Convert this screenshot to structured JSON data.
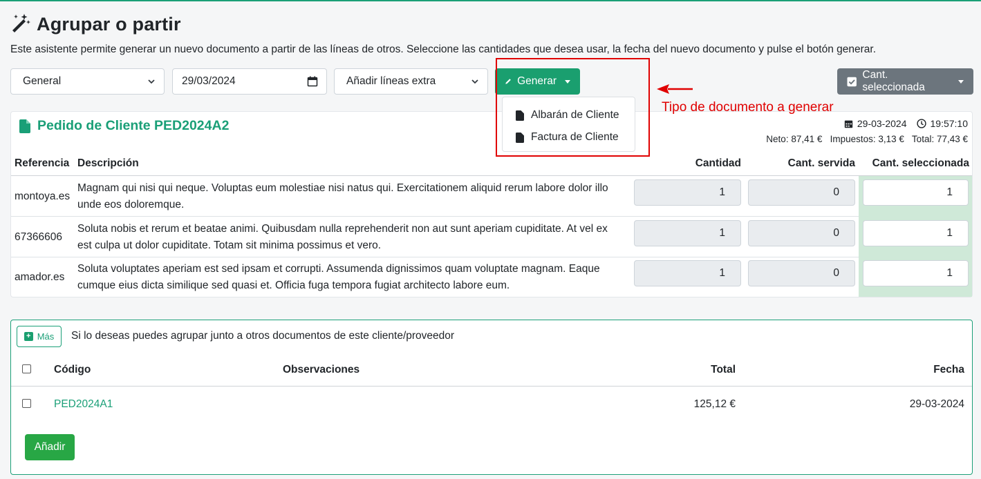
{
  "page": {
    "title": "Agrupar o partir",
    "intro": "Este asistente permite generar un nuevo documento a partir de las líneas de otros. Seleccione las cantidades que desea usar, la fecha del nuevo documento y pulse el botón generar."
  },
  "toolbar": {
    "type_select": "General",
    "date_value": "29/03/2024",
    "extra_select": "Añadir líneas extra",
    "generate_label": "Generar",
    "dropdown_items": [
      "Albarán de Cliente",
      "Factura de Cliente"
    ],
    "selected_qty_label": "Cant. seleccionada"
  },
  "annotation": "Tipo de documento a generar",
  "document": {
    "title": "Pedido de Cliente PED2024A2",
    "date": "29-03-2024",
    "time": "19:57:10",
    "totals": "Neto: 87,41 €   Impuestos: 3,13 €   Total: 77,43 €",
    "headers": {
      "ref": "Referencia",
      "desc": "Descripción",
      "qty": "Cantidad",
      "served": "Cant. servida",
      "selected": "Cant. seleccionada"
    },
    "lines": [
      {
        "ref": "montoya.es",
        "desc1": "Magnam qui nisi qui neque. Voluptas eum molestiae nisi natus qui. Exercitationem aliquid rerum labore dolor illo",
        "desc2": "unde eos doloremque.",
        "qty": "1",
        "served": "0",
        "selected": "1"
      },
      {
        "ref": "67366606",
        "desc1": "Soluta nobis et rerum et beatae animi. Quibusdam nulla reprehenderit non aut sunt aperiam cupiditate. At vel ex",
        "desc2": "est culpa ut dolor cupiditate. Totam sit minima possimus et vero.",
        "qty": "1",
        "served": "0",
        "selected": "1"
      },
      {
        "ref": "amador.es",
        "desc1": "Soluta voluptates aperiam est sed ipsam et corrupti. Assumenda dignissimos quam voluptate magnam. Eaque",
        "desc2": "cumque eius dicta similique sed quasi et. Officia fuga tempora fugiat architecto labore eum.",
        "qty": "1",
        "served": "0",
        "selected": "1"
      }
    ]
  },
  "group": {
    "more_label": "Más",
    "hint": "Si lo deseas puedes agrupar junto a otros documentos de este cliente/proveedor",
    "headers": {
      "code": "Código",
      "notes": "Observaciones",
      "total": "Total",
      "date": "Fecha"
    },
    "rows": [
      {
        "code": "PED2024A1",
        "notes": "",
        "total": "125,12 €",
        "date": "29-03-2024"
      }
    ],
    "add_label": "Añadir"
  },
  "colors": {
    "accent": "#1a9f77",
    "annotation": "#e00000",
    "selected_col": "#cfe9d8"
  },
  "icons": [
    "magic-wand-icon",
    "calendar-icon",
    "pencil-icon",
    "file-icon",
    "checkbox-checked-icon",
    "clock-icon",
    "plus-square-icon",
    "arrow-left-icon"
  ]
}
